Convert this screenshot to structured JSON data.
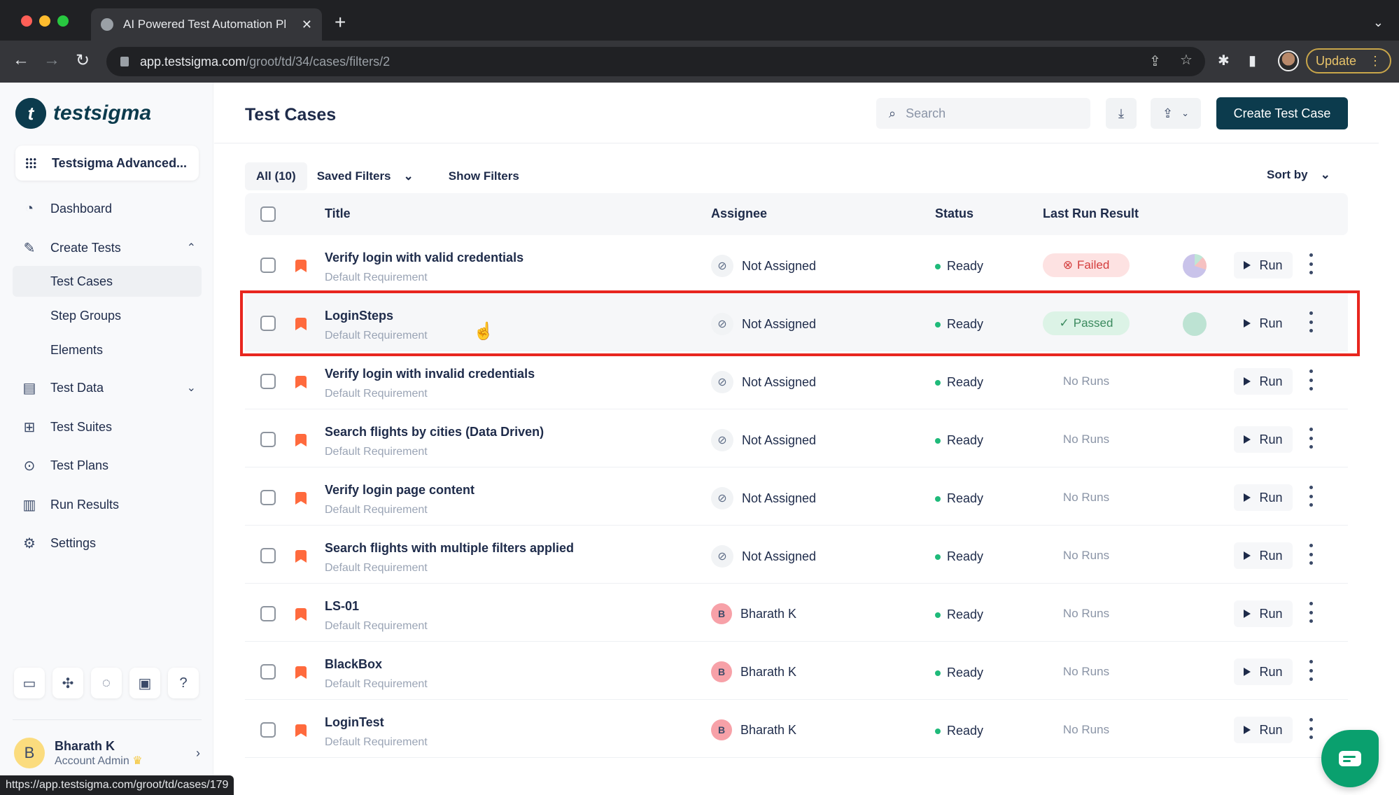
{
  "browser": {
    "tab_title": "AI Powered Test Automation Pl",
    "url_host": "app.testsigma.com",
    "url_path": "/groot/td/34/cases/filters/2",
    "update_label": "Update",
    "status_url": "https://app.testsigma.com/groot/td/cases/179"
  },
  "sidebar": {
    "logo_text": "testsigma",
    "project_name": "Testsigma Advanced...",
    "items": [
      {
        "label": "Dashboard",
        "icon": "gauge-icon"
      },
      {
        "label": "Create Tests",
        "icon": "pencil-icon",
        "expanded": true
      },
      {
        "label": "Test Data",
        "icon": "folder-icon",
        "expanded": false
      },
      {
        "label": "Test Suites",
        "icon": "grid-icon"
      },
      {
        "label": "Test Plans",
        "icon": "play-circle-icon"
      },
      {
        "label": "Run Results",
        "icon": "bar-chart-icon"
      },
      {
        "label": "Settings",
        "icon": "gear-icon"
      }
    ],
    "sub_items": [
      "Test Cases",
      "Step Groups",
      "Elements"
    ],
    "active_sub_item": "Test Cases",
    "tools": [
      "devices-icon",
      "puzzle-icon",
      "loader-icon",
      "gift-icon",
      "help-icon"
    ],
    "user": {
      "initial": "B",
      "name": "Bharath K",
      "role": "Account Admin"
    }
  },
  "header": {
    "title": "Test Cases",
    "search_placeholder": "Search",
    "create_label": "Create Test Case"
  },
  "filters": {
    "all_label": "All (10)",
    "saved_label": "Saved Filters",
    "show_label": "Show Filters",
    "sort_label": "Sort by"
  },
  "table": {
    "columns": [
      "Title",
      "Assignee",
      "Status",
      "Last Run Result"
    ],
    "run_label": "Run",
    "rows": [
      {
        "title": "Verify login with valid credentials",
        "req": "Default Requirement",
        "assignee": "Not Assigned",
        "assignee_initial": "",
        "status": "Ready",
        "result": "Failed",
        "result_type": "failed"
      },
      {
        "title": "LoginSteps",
        "req": "Default Requirement",
        "assignee": "Not Assigned",
        "assignee_initial": "",
        "status": "Ready",
        "result": "Passed",
        "result_type": "passed"
      },
      {
        "title": "Verify login with invalid credentials",
        "req": "Default Requirement",
        "assignee": "Not Assigned",
        "assignee_initial": "",
        "status": "Ready",
        "result": "No Runs",
        "result_type": "none"
      },
      {
        "title": "Search flights by cities (Data Driven)",
        "req": "Default Requirement",
        "assignee": "Not Assigned",
        "assignee_initial": "",
        "status": "Ready",
        "result": "No Runs",
        "result_type": "none"
      },
      {
        "title": "Verify login page content",
        "req": "Default Requirement",
        "assignee": "Not Assigned",
        "assignee_initial": "",
        "status": "Ready",
        "result": "No Runs",
        "result_type": "none"
      },
      {
        "title": "Search flights with multiple filters applied",
        "req": "Default Requirement",
        "assignee": "Not Assigned",
        "assignee_initial": "",
        "status": "Ready",
        "result": "No Runs",
        "result_type": "none"
      },
      {
        "title": "LS-01",
        "req": "Default Requirement",
        "assignee": "Bharath K",
        "assignee_initial": "B",
        "status": "Ready",
        "result": "No Runs",
        "result_type": "none"
      },
      {
        "title": "BlackBox",
        "req": "Default Requirement",
        "assignee": "Bharath K",
        "assignee_initial": "B",
        "status": "Ready",
        "result": "No Runs",
        "result_type": "none"
      },
      {
        "title": "LoginTest",
        "req": "Default Requirement",
        "assignee": "Bharath K",
        "assignee_initial": "B",
        "status": "Ready",
        "result": "No Runs",
        "result_type": "none"
      }
    ]
  },
  "colors": {
    "brand": "#0c3b4d",
    "ready": "#1fba7a",
    "failed": "#d43d3d",
    "passed": "#3b8a5e",
    "highlight": "#e8261f",
    "chat": "#0aa06e"
  }
}
